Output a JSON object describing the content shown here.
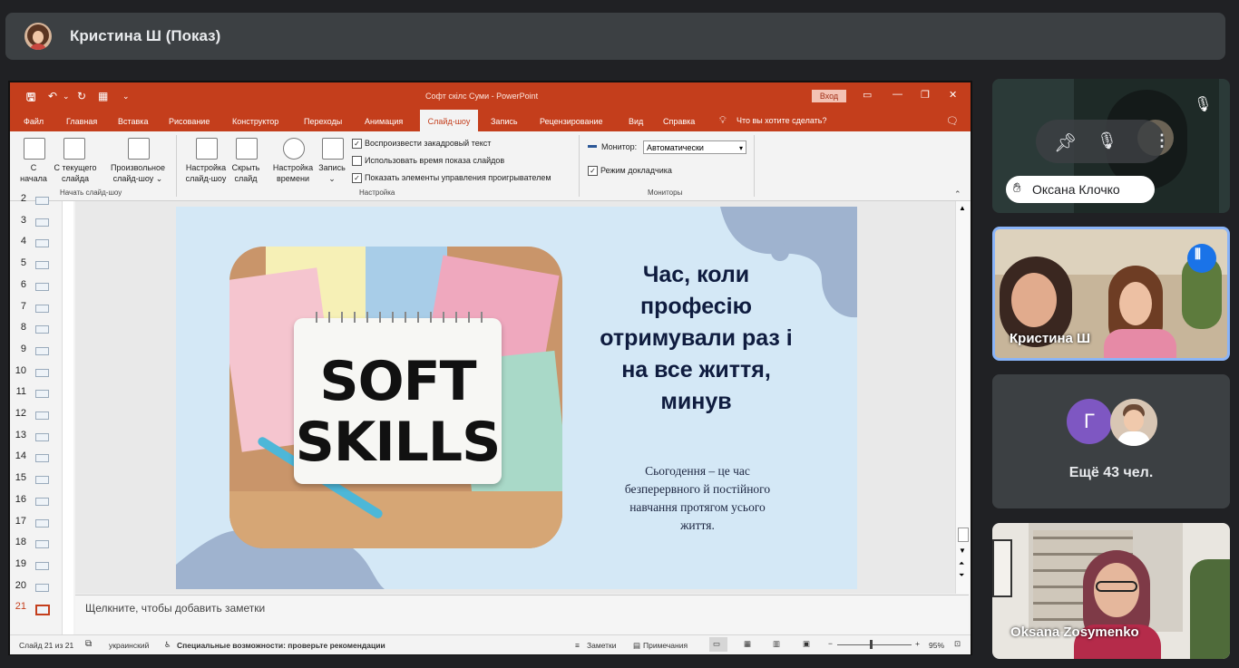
{
  "presenter": {
    "title": "Кристина Ш (Показ)"
  },
  "ppt": {
    "doc_title": "Софт скілс Суми  -  PowerPoint",
    "signin": "Вход",
    "tabs": [
      "Файл",
      "Главная",
      "Вставка",
      "Рисование",
      "Конструктор",
      "Переходы",
      "Анимация",
      "Слайд-шоу",
      "Запись",
      "Рецензирование",
      "Вид",
      "Справка"
    ],
    "active_tab": "Слайд-шоу",
    "tellme": "Что вы хотите сделать?",
    "ribbon": {
      "btn_from_start": "С\nначала",
      "btn_from_current": "С текущего\nслайда",
      "btn_custom": "Произвольное\nслайд-шоу ⌄",
      "group_start": "Начать слайд-шоу",
      "btn_setup": "Настройка\nслайд-шоу",
      "btn_hide": "Скрыть\nслайд",
      "btn_timing": "Настройка\nвремени",
      "btn_record": "Запись\n⌄",
      "chk_narration": "Воспроизвести закадровый текст",
      "chk_timings": "Использовать время показа слайдов",
      "chk_controls": "Показать элементы управления проигрывателем",
      "group_setup": "Настройка",
      "monitor_label": "Монитор:",
      "monitor_value": "Автоматически",
      "presenter_view": "Режим докладчика",
      "group_monitors": "Мониторы"
    },
    "thumbnails": [
      "2",
      "3",
      "4",
      "5",
      "6",
      "7",
      "8",
      "9",
      "10",
      "11",
      "12",
      "13",
      "14",
      "15",
      "16",
      "17",
      "18",
      "19",
      "20",
      "21"
    ],
    "active_slide": "21",
    "slide": {
      "heading": "Час, коли\nпрофесію\nотримували раз і\nна все життя,\nминув",
      "body": "Сьогодення – це час\nбезперервного й постійного\nнавчання протягом усього\nжиття.",
      "notebook_line1": "SOFT",
      "notebook_line2": "SKILLS"
    },
    "notes_placeholder": "Щелкните, чтобы добавить заметки",
    "status": {
      "slide_of": "Слайд 21 из 21",
      "language": "украинский",
      "accessibility": "Специальные возможности: проверьте рекомендации",
      "notes": "Заметки",
      "comments": "Примечания",
      "zoom": "95%"
    }
  },
  "tiles": {
    "tile1_name": "Оксана Клочко",
    "tile2_name": "Кристина Ш",
    "tile3_avatar_letter": "Г",
    "tile3_more": "Ещё 43 чел.",
    "tile4_name": "Oksana Zosymenko"
  },
  "colors": {
    "ppt_accent": "#c43e1c",
    "meet_bg": "#202124",
    "tile_bg": "#3c4043",
    "speaking_border": "#8ab4f8",
    "avatar_purple": "#7e57c2"
  }
}
